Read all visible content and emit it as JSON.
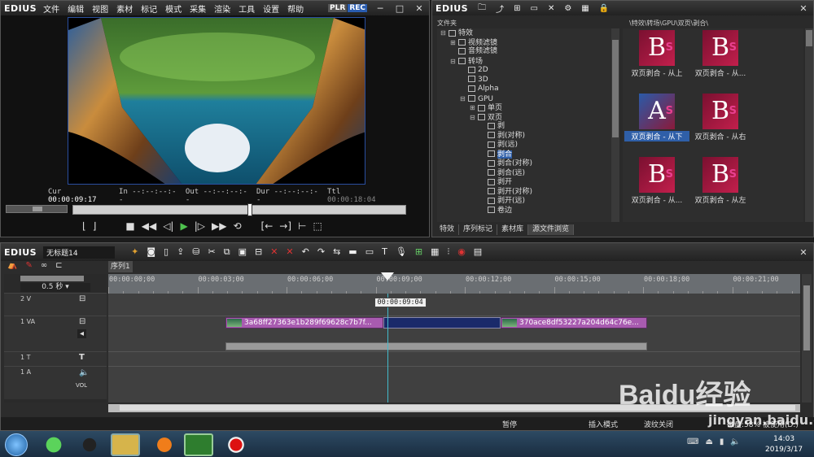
{
  "app": {
    "logo": "EDIUS",
    "menu": [
      "文件",
      "编辑",
      "视图",
      "素材",
      "标记",
      "模式",
      "采集",
      "渲染",
      "工具",
      "设置",
      "帮助"
    ],
    "plr": "PLR",
    "rec": "REC"
  },
  "player": {
    "cur_label": "Cur",
    "cur": "00:00:09:17",
    "in_label": "In",
    "in": "--:--:--:--",
    "out_label": "Out",
    "out": "--:--:--:--",
    "dur_label": "Dur",
    "dur": "--:--:--:--",
    "ttl_label": "Ttl",
    "ttl": "00:00:18:04",
    "position": 0.53
  },
  "bin": {
    "logo": "EDIUS",
    "folder_header": "文件夹",
    "path": "\\特效\\转场\\GPU\\双页\\剥合\\",
    "tree": [
      {
        "t": "特效",
        "l": 0,
        "s": "-"
      },
      {
        "t": "视频滤镜",
        "l": 1,
        "s": "+"
      },
      {
        "t": "音频滤镜",
        "l": 1,
        "s": ""
      },
      {
        "t": "转场",
        "l": 1,
        "s": "-"
      },
      {
        "t": "2D",
        "l": 2,
        "s": ""
      },
      {
        "t": "3D",
        "l": 2,
        "s": ""
      },
      {
        "t": "Alpha",
        "l": 2,
        "s": ""
      },
      {
        "t": "GPU",
        "l": 2,
        "s": "-"
      },
      {
        "t": "单页",
        "l": 3,
        "s": "+"
      },
      {
        "t": "双页",
        "l": 3,
        "s": "-"
      },
      {
        "t": "剥",
        "l": 4,
        "s": ""
      },
      {
        "t": "剥(对称)",
        "l": 4,
        "s": ""
      },
      {
        "t": "剥(远)",
        "l": 4,
        "s": ""
      },
      {
        "t": "剥合",
        "l": 4,
        "s": "",
        "sel": true
      },
      {
        "t": "剥合(对称)",
        "l": 4,
        "s": ""
      },
      {
        "t": "剥合(远)",
        "l": 4,
        "s": ""
      },
      {
        "t": "剥开",
        "l": 4,
        "s": ""
      },
      {
        "t": "剥开(对称)",
        "l": 4,
        "s": ""
      },
      {
        "t": "剥开(远)",
        "l": 4,
        "s": ""
      },
      {
        "t": "卷边",
        "l": 4,
        "s": ""
      }
    ],
    "effects": [
      {
        "label": "双页剥合 - 从上",
        "glyph": "B"
      },
      {
        "label": "双页剥合 - 从...",
        "glyph": "B"
      },
      {
        "label": "双页剥合 - 从下",
        "glyph": "A",
        "sel": true
      },
      {
        "label": "双页剥合 - 从右",
        "glyph": "B"
      },
      {
        "label": "双页剥合 - 从...",
        "glyph": "B"
      },
      {
        "label": "双页剥合 - 从左",
        "glyph": "B"
      }
    ],
    "tabs": [
      "特效",
      "序列标记",
      "素材库",
      "源文件浏览"
    ]
  },
  "timeline": {
    "logo": "EDIUS",
    "project": "无标题14",
    "sequence_tab": "序列1",
    "zoom": "0.5 秒",
    "ruler": [
      "00:00:00;00",
      "00:00:03;00",
      "00:00:06;00",
      "00:00:09;00",
      "00:00:12;00",
      "00:00:15;00",
      "00:00:18;00",
      "00:00:21;00"
    ],
    "tooltip": "00:00:09:04",
    "tracks": [
      {
        "name": "2 V"
      },
      {
        "name": "1 VA"
      },
      {
        "name": "1 T"
      },
      {
        "name": "1 A"
      }
    ],
    "clip1": "3a68ff27363e1b289f69628c7b7f...",
    "clip2": "370ace8df53227a204d64c76e...",
    "vol": "VOL"
  },
  "status": {
    "pause": "暂停",
    "insert": "插入模式",
    "ripple": "波纹关闭",
    "disk": "磁盘:58% 被使用(D:)"
  },
  "taskbar": {
    "time": "14:03",
    "date": "2019/3/17"
  },
  "watermark": {
    "brand": "Baidu经验",
    "url": "jingyan.baidu.com"
  }
}
